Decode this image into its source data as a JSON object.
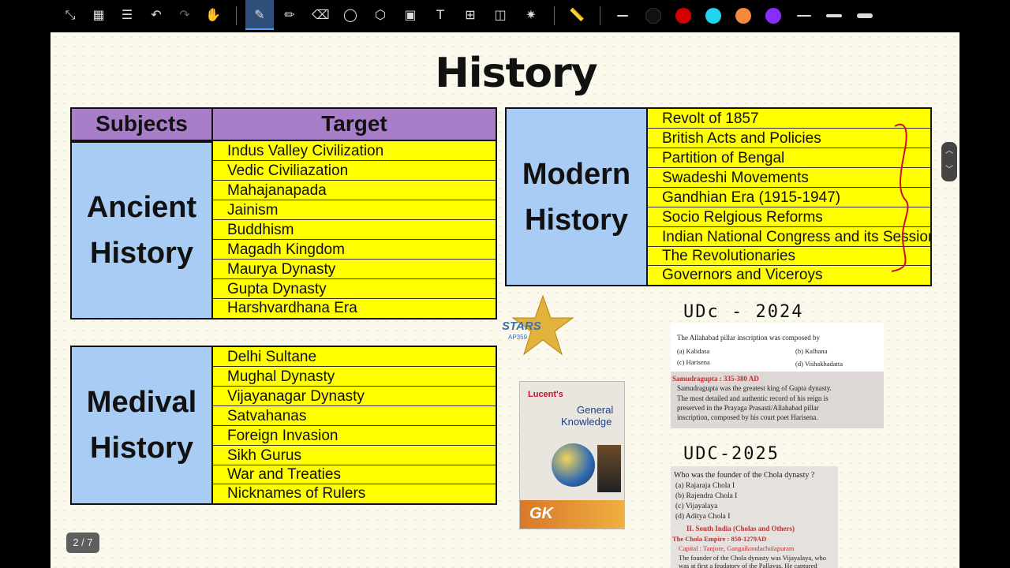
{
  "toolbar": {
    "icons": [
      "collapse-icon",
      "grid-icon",
      "list-icon",
      "undo-icon",
      "redo-icon",
      "lasso-icon",
      "pen-icon",
      "highlighter-icon",
      "eraser-icon",
      "shape-lasso-icon",
      "shapes-icon",
      "image-icon",
      "text-icon",
      "table-icon",
      "chart-icon",
      "laser-icon",
      "ruler-icon"
    ],
    "colors": [
      "#111111",
      "#d40000",
      "#22d3ee",
      "#f4883b",
      "#8b2cff"
    ]
  },
  "title": "History",
  "ancient": {
    "header_subjects": "Subjects",
    "header_target": "Target",
    "label_line1": "Ancient",
    "label_line2": "History",
    "items": [
      "Indus Valley Civilization",
      "Vedic Civiliazation",
      "Mahajanapada",
      "Jainism",
      "Buddhism",
      "Magadh Kingdom",
      "Maurya Dynasty",
      "Gupta Dynasty",
      "Harshvardhana Era"
    ]
  },
  "medieval": {
    "label_line1": "Medival",
    "label_line2": "History",
    "items": [
      "Delhi Sultane",
      "Mughal Dynasty",
      "Vijayanagar Dynasty",
      "Satvahanas",
      "Foreign Invasion",
      "Sikh Gurus",
      "War and Treaties",
      "Nicknames of Rulers"
    ]
  },
  "modern": {
    "label_line1": "Modern",
    "label_line2": "History",
    "items": [
      "Revolt of 1857",
      "British Acts and Policies",
      "Partition of Bengal",
      "Swadeshi Movements",
      "Gandhian Era (1915-1947)",
      "Socio Relgious Reforms",
      "Indian National Congress and its Sessions",
      "The Revolutionaries",
      "Governors and Viceroys"
    ]
  },
  "logo": {
    "line1": "STARS",
    "line2": "AP359"
  },
  "book": {
    "brand": "Lucent's",
    "title_line1": "General",
    "title_line2": "Knowledge",
    "badge": "GK"
  },
  "udc2024": {
    "label": "UDc - 2024",
    "question": "The Allahabad pillar inscription was composed by",
    "options": [
      "(a)  Kalidasa",
      "(b)  Kalhana",
      "(c)  Harisena",
      "(d)  Vishakhadatta"
    ],
    "note_heading": "Samudragupta : 335-380 AD",
    "note_line1": "Samudragupta was the greatest king of Gupta dynasty.",
    "note_line2": "The most detailed and authentic record of his reign is",
    "note_line3": "preserved in the Prayaga Prasasti/Allahabad pillar",
    "note_line4": "inscription, composed by his court poet Harisena."
  },
  "udc2025": {
    "label": "UDC-2025",
    "question": "Who was the founder of the Chola dynasty ?",
    "options": [
      "(a)  Rajaraja Chola I",
      "(b)  Rajendra Chola I",
      "(c)  Vijayalaya",
      "(d)  Aditya Chola I"
    ],
    "note_heading": "II. South India (Cholas and Others)",
    "note_line1": "The Chola Empire : 850-1279AD",
    "note_line2": "Capital : Tanjore, Gangaikondacholapuram",
    "note_line3": "The founder of the Chola dynasty was Vijayalaya, who",
    "note_line4": "was at first a feudatory of the Pallavas. He captured"
  },
  "page_indicator": "2 / 7"
}
